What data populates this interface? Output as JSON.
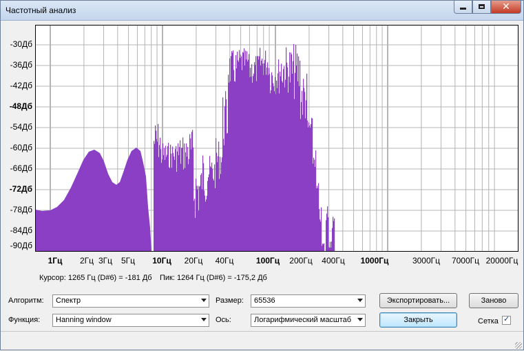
{
  "window": {
    "title": "Частотный анализ"
  },
  "plot": {
    "y_labels": [
      {
        "text": "-30Дб",
        "bold": false
      },
      {
        "text": "-36Дб",
        "bold": false
      },
      {
        "text": "-42Дб",
        "bold": false
      },
      {
        "text": "-48Дб",
        "bold": true
      },
      {
        "text": "-54Дб",
        "bold": false
      },
      {
        "text": "-60Дб",
        "bold": false
      },
      {
        "text": "-66Дб",
        "bold": false
      },
      {
        "text": "-72Дб",
        "bold": true
      },
      {
        "text": "-78Дб",
        "bold": false
      },
      {
        "text": "-84Дб",
        "bold": false
      },
      {
        "text": "-90Дб",
        "bold": false
      }
    ],
    "x_labels": [
      {
        "text": "1Гц",
        "bold": true
      },
      {
        "text": "2Гц",
        "bold": false
      },
      {
        "text": "3Гц",
        "bold": false
      },
      {
        "text": "5Гц",
        "bold": false
      },
      {
        "text": "10Гц",
        "bold": true
      },
      {
        "text": "20Гц",
        "bold": false
      },
      {
        "text": "40Гц",
        "bold": false
      },
      {
        "text": "100Гц",
        "bold": true
      },
      {
        "text": "200Гц",
        "bold": false
      },
      {
        "text": "400Гц",
        "bold": false
      },
      {
        "text": "1000Гц",
        "bold": true
      },
      {
        "text": "3000Гц",
        "bold": false
      },
      {
        "text": "7000Гц",
        "bold": false
      },
      {
        "text": "20000Гц",
        "bold": false
      }
    ],
    "fill_color": "#8b3fc4",
    "grid_color": "#b4b4b4"
  },
  "info": {
    "cursor": "Курсор: 1265 Гц (D#6) = -181 Дб",
    "peak": "Пик: 1264 Гц (D#6) = -175,2 Дб"
  },
  "controls": {
    "algorithm_label": "Алгоритм:",
    "algorithm_value": "Спектр",
    "function_label": "Функция:",
    "function_value": "Hanning window",
    "size_label": "Размер:",
    "size_value": "65536",
    "axis_label": "Ось:",
    "axis_value": "Логарифмический масштаб",
    "export_button": "Экспортировать...",
    "replot_button": "Заново",
    "close_button": "Закрыть",
    "grid_label": "Сетка",
    "grid_checked": true
  }
}
